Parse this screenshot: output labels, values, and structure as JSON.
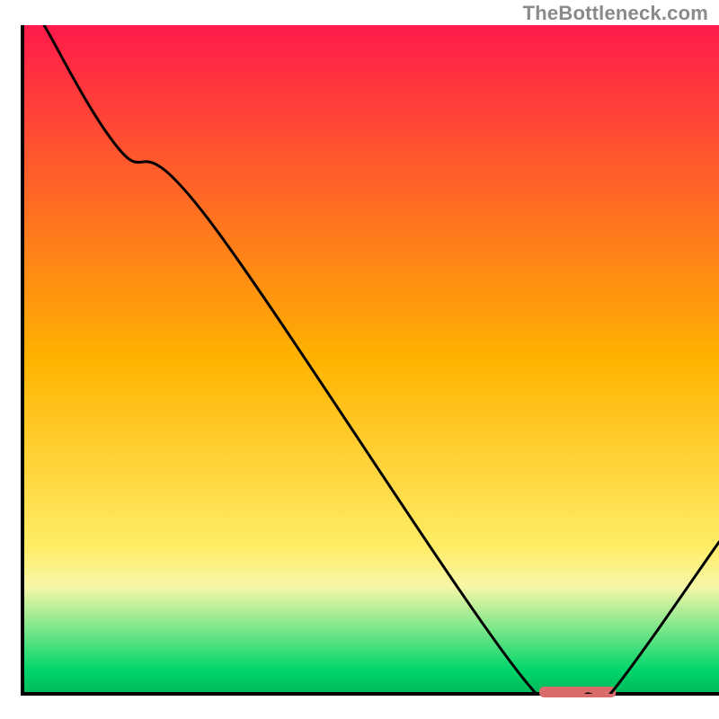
{
  "attribution": "TheBottleneck.com",
  "chart_data": {
    "type": "line",
    "title": "",
    "xlabel": "",
    "ylabel": "",
    "xlim": [
      0,
      100
    ],
    "ylim": [
      0,
      100
    ],
    "axes_visible": false,
    "background": {
      "type": "vertical_gradient",
      "stops": [
        {
          "offset": 0.0,
          "color": "#ff1a4b"
        },
        {
          "offset": 0.5,
          "color": "#ffb300"
        },
        {
          "offset": 0.78,
          "color": "#ffed66"
        },
        {
          "offset": 0.84,
          "color": "#f7f7a8"
        },
        {
          "offset": 0.965,
          "color": "#00d66b"
        },
        {
          "offset": 1.0,
          "color": "#00b85a"
        }
      ]
    },
    "curve": {
      "name": "bottleneck",
      "x": [
        3.1,
        14.0,
        26.6,
        71.9,
        81.3,
        84.4,
        100.0
      ],
      "y": [
        100.0,
        81.3,
        71.1,
        2.3,
        0.0,
        0.0,
        22.7
      ]
    },
    "optimal_marker": {
      "x_start": 74.2,
      "x_end": 85.2,
      "y": 0.0,
      "color": "#d96b6b"
    },
    "frame": {
      "left_x": 3.1,
      "bottom_y": 0.0
    }
  }
}
